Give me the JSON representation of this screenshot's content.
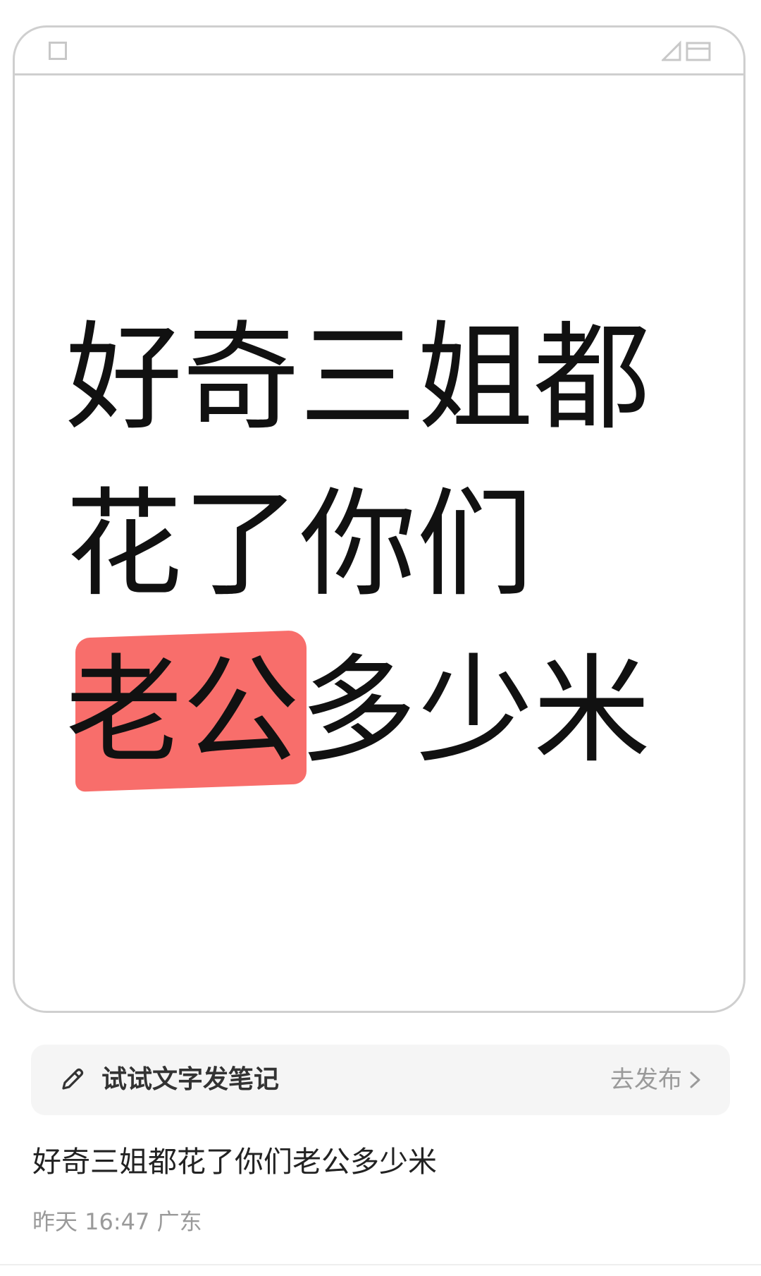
{
  "card": {
    "lines": [
      "好奇三姐都",
      "花了你们",
      "多少米"
    ],
    "highlight_text": "老公",
    "highlight_color": "#f86e6b"
  },
  "prompt_bar": {
    "icon": "pencil-icon",
    "text": "试试文字发笔记",
    "action_label": "去发布",
    "action_icon": "chevron-right-icon"
  },
  "post": {
    "title": "好奇三姐都花了你们老公多少米",
    "time": "昨天 16:47",
    "location": "广东"
  }
}
